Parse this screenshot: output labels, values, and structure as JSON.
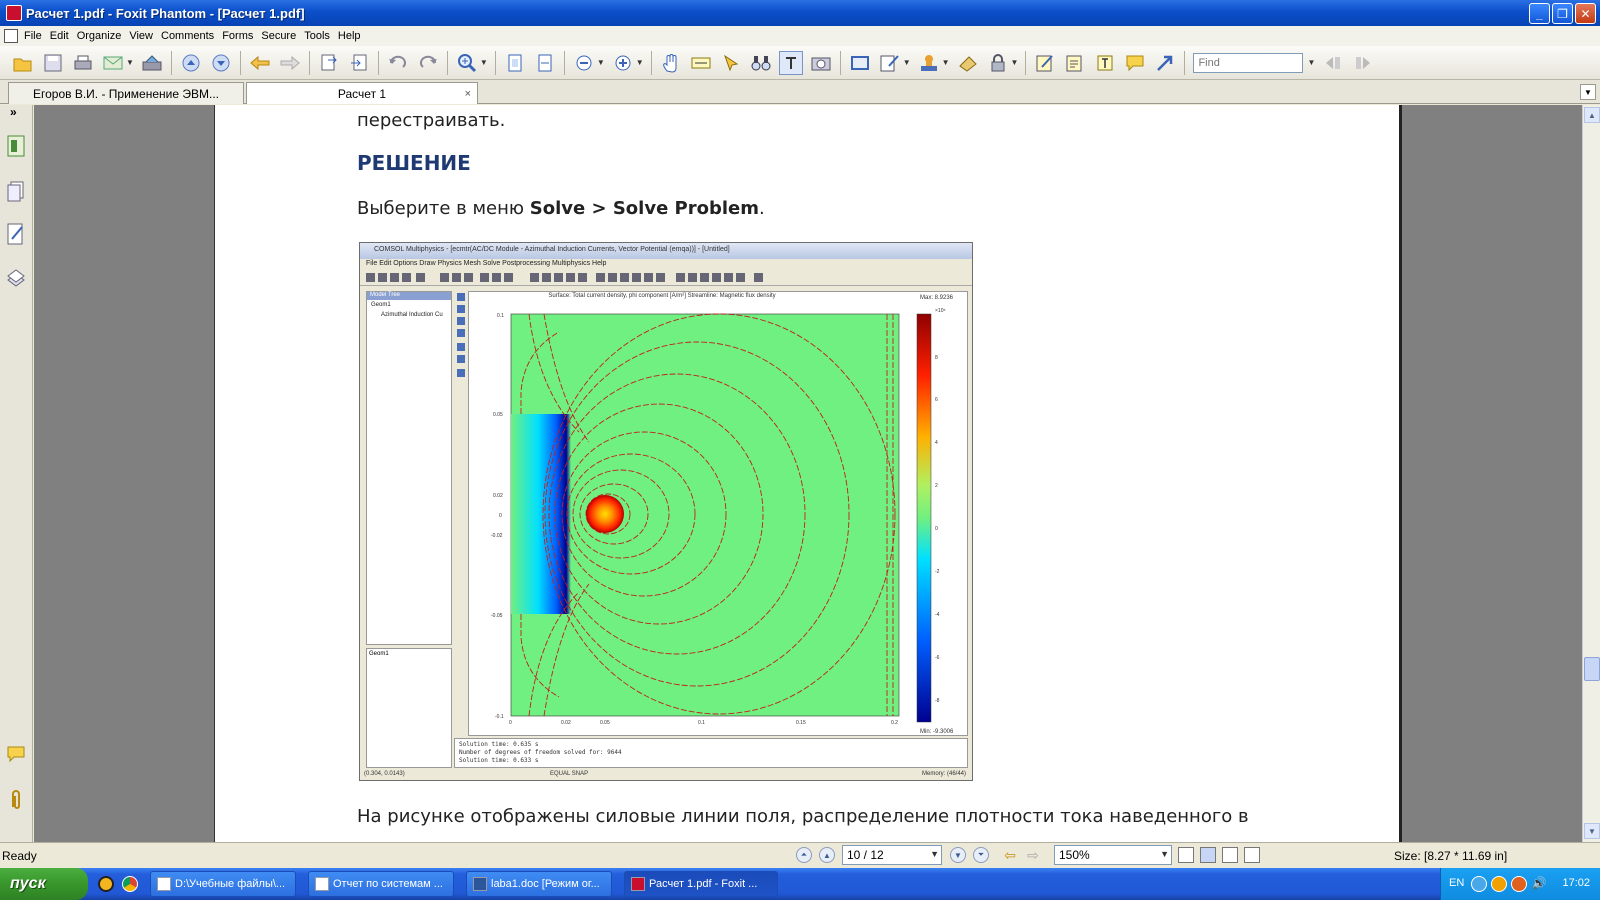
{
  "window": {
    "title": "Расчет 1.pdf - Foxit Phantom - [Расчет 1.pdf]",
    "minimize_label": "_",
    "restore_label": "❐",
    "close_label": "✕"
  },
  "menu": [
    "File",
    "Edit",
    "Organize",
    "View",
    "Comments",
    "Forms",
    "Secure",
    "Tools",
    "Help"
  ],
  "toolbar": {
    "icons": [
      "open-icon",
      "save-icon",
      "print-icon",
      "email-icon",
      "scan-icon",
      "page-up-icon",
      "page-down-icon",
      "back-icon",
      "forward-icon",
      "extract-icon",
      "insert-icon",
      "undo-icon",
      "redo-icon",
      "zoom-in-icon",
      "fit-page-icon",
      "fit-width-icon",
      "zoom-out-minus-icon",
      "zoom-in-plus-icon",
      "hand-icon",
      "select-text-icon",
      "select-icon",
      "binoculars-icon",
      "typewriter-icon",
      "snapshot-icon",
      "rectangle-icon",
      "edit-icon",
      "stamp-icon",
      "attach-icon",
      "lock-icon",
      "highlight-icon",
      "note-edit-icon",
      "textbox-icon",
      "comment-icon",
      "arrow-icon"
    ],
    "find_placeholder": "Find"
  },
  "tabs": [
    {
      "label": "Егоров В.И. - Применение ЭВМ...",
      "active": false
    },
    {
      "label": "Расчет 1",
      "active": true,
      "close": "×"
    }
  ],
  "document": {
    "line_top": "перестраивать.",
    "heading": "РЕШЕНИЕ",
    "instruction_prefix": "Выберите в меню ",
    "instruction_bold": "Solve > Solve Problem",
    "instruction_suffix": ".",
    "bottom_line": "На рисунке отображены силовые линии поля, распределение плотности тока наведенного в"
  },
  "figure": {
    "title": "COMSOL Multiphysics - [ecmtr(AC/DC Module - Azimuthal Induction Currents, Vector Potential (emqa))] - [Untitled]",
    "menu": "File  Edit  Options  Draw  Physics  Mesh  Solve  Postprocessing  Multiphysics  Help",
    "model_tree_title": "Model Tree",
    "model_tree_items": [
      "Geom1",
      "Azimuthal Induction Cu"
    ],
    "props_label": "Geom1",
    "plot_label": "Surface: Total current density, phi component [A/m²]   Streamline: Magnetic flux density",
    "max_label": "Max: 8.9236",
    "min_label": "Min: -9.3006",
    "log_lines": [
      "Solution time: 0.635 s",
      "Number of degrees of freedom solved for: 9644",
      "Solution time: 0.633 s"
    ],
    "status_left": "(0.304, 0.0143)",
    "status_mid": "EQUAL  SNAP",
    "status_right": "Memory: (46/44)"
  },
  "chart_data": {
    "type": "heatmap",
    "title": "Surface: Total current density, phi component [A/m²]   Streamline: Magnetic flux density",
    "xlabel": "",
    "ylabel": "",
    "x_ticks": [
      "0",
      "0.02",
      "0.05",
      "0.1",
      "0.15",
      "0.2"
    ],
    "y_ticks": [
      "0.1",
      "0.05",
      "0.02",
      "0",
      "-0.02",
      "-0.05",
      "-0.1"
    ],
    "colorbar_ticks": [
      "8",
      "6",
      "4",
      "2",
      "0",
      "-2",
      "-4",
      "-6",
      "-8"
    ],
    "colorbar_exponent": "×10⁵",
    "max_label": "Max: 8.9236",
    "min_label": "Min: -9.3006",
    "colormap": [
      "#00008f",
      "#0060ff",
      "#00e0ff",
      "#70f080",
      "#ffe000",
      "#ff6000",
      "#b00000"
    ]
  },
  "status": {
    "ready": "Ready",
    "page": "10 / 12",
    "zoom": "150%",
    "size": "Size: [8.27 * 11.69 in]"
  },
  "taskbar": {
    "start": "пуск",
    "tasks": [
      {
        "label": "D:\\Учебные файлы\\...",
        "active": false
      },
      {
        "label": "Отчет по системам ...",
        "active": false
      },
      {
        "label": "laba1.doc [Режим ог...",
        "active": false
      },
      {
        "label": "Расчет 1.pdf - Foxit ...",
        "active": true
      }
    ],
    "lang": "EN",
    "clock": "17:02"
  }
}
